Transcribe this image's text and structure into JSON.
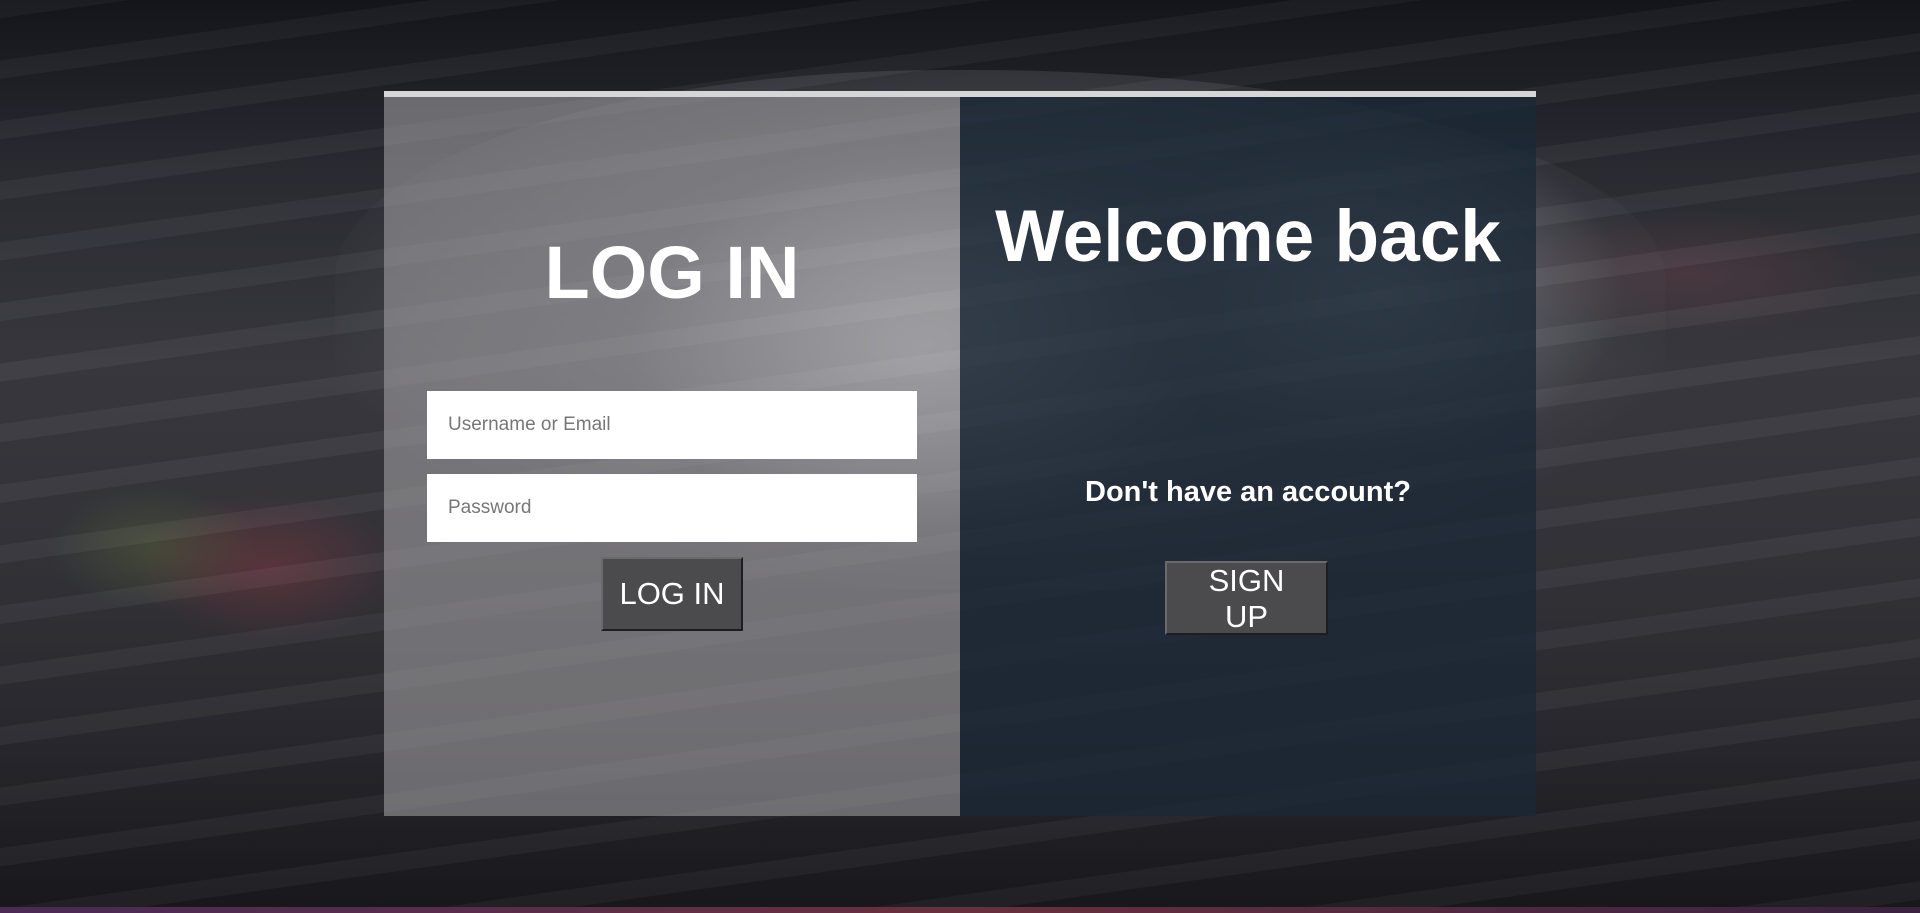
{
  "login": {
    "title": "LOG IN",
    "username_placeholder": "Username or Email",
    "password_placeholder": "Password",
    "submit_label": "LOG IN"
  },
  "signup": {
    "heading": "Welcome back",
    "prompt": "Don't have an account?",
    "button_label": "SIGN UP"
  },
  "colors": {
    "left_panel": "#a9a7a9",
    "right_panel": "#1c2837",
    "button": "#4b4b4d",
    "text": "#ffffff"
  }
}
